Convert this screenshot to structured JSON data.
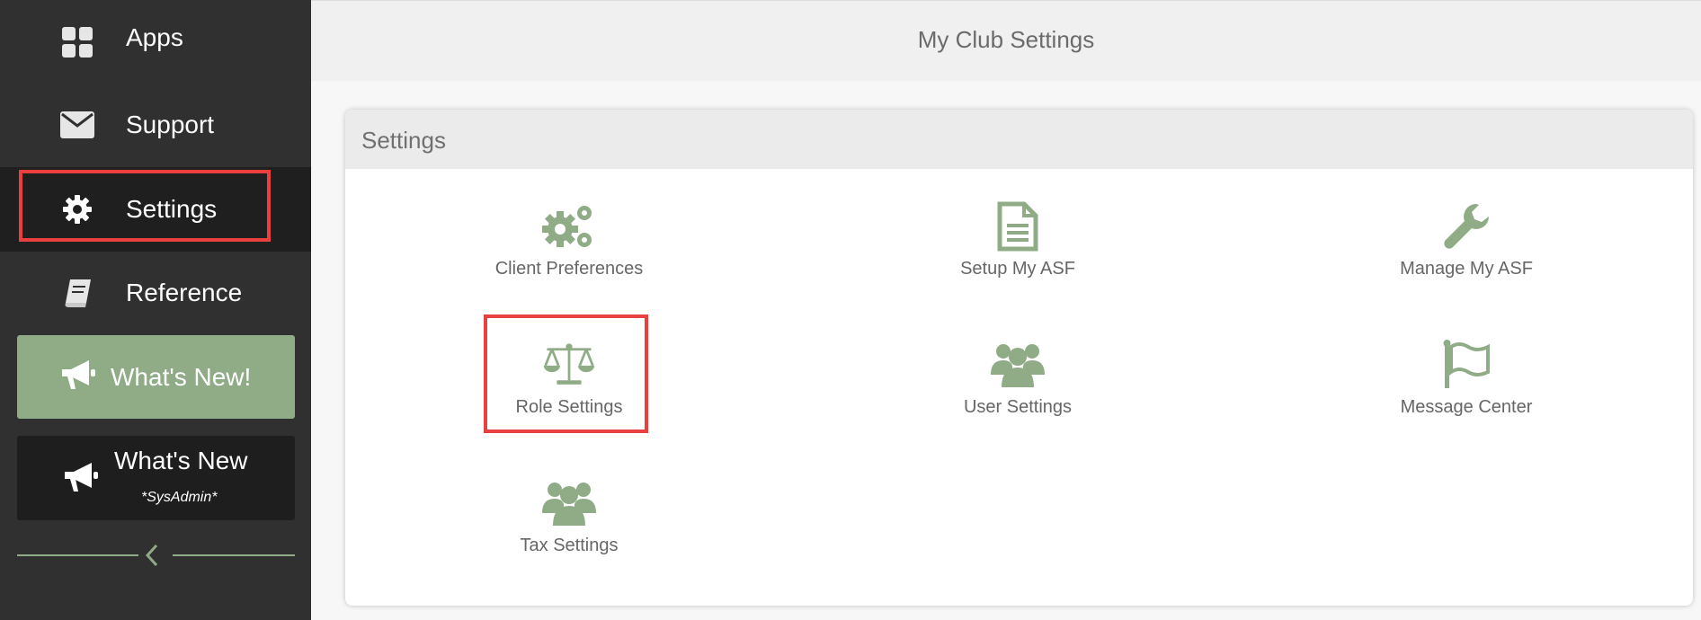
{
  "sidebar": {
    "items": [
      {
        "label": "Apps",
        "icon": "grid-icon"
      },
      {
        "label": "Support",
        "icon": "envelope-icon"
      },
      {
        "label": "Settings",
        "icon": "gear-icon",
        "active": true
      },
      {
        "label": "Reference",
        "icon": "book-icon"
      }
    ],
    "whats_new": {
      "label": "What's New!",
      "icon": "megaphone-icon"
    },
    "whats_new_sys": {
      "label": "What's New",
      "sub": "*SysAdmin*",
      "icon": "megaphone-icon"
    },
    "collapse_icon": "chevron-left-icon"
  },
  "header": {
    "title": "My Club Settings"
  },
  "panel": {
    "title": "Settings",
    "tiles": [
      {
        "label": "Client Preferences",
        "icon": "gears-icon"
      },
      {
        "label": "Setup My ASF",
        "icon": "document-icon"
      },
      {
        "label": "Manage My ASF",
        "icon": "wrench-icon"
      },
      {
        "label": "Role Settings",
        "icon": "balance-scale-icon"
      },
      {
        "label": "User Settings",
        "icon": "users-icon"
      },
      {
        "label": "Message Center",
        "icon": "flag-icon"
      },
      {
        "label": "Tax Settings",
        "icon": "users-icon"
      }
    ]
  },
  "colors": {
    "sidebar_bg": "#303030",
    "accent_green": "#8fac87",
    "highlight_red": "#e8403f"
  }
}
